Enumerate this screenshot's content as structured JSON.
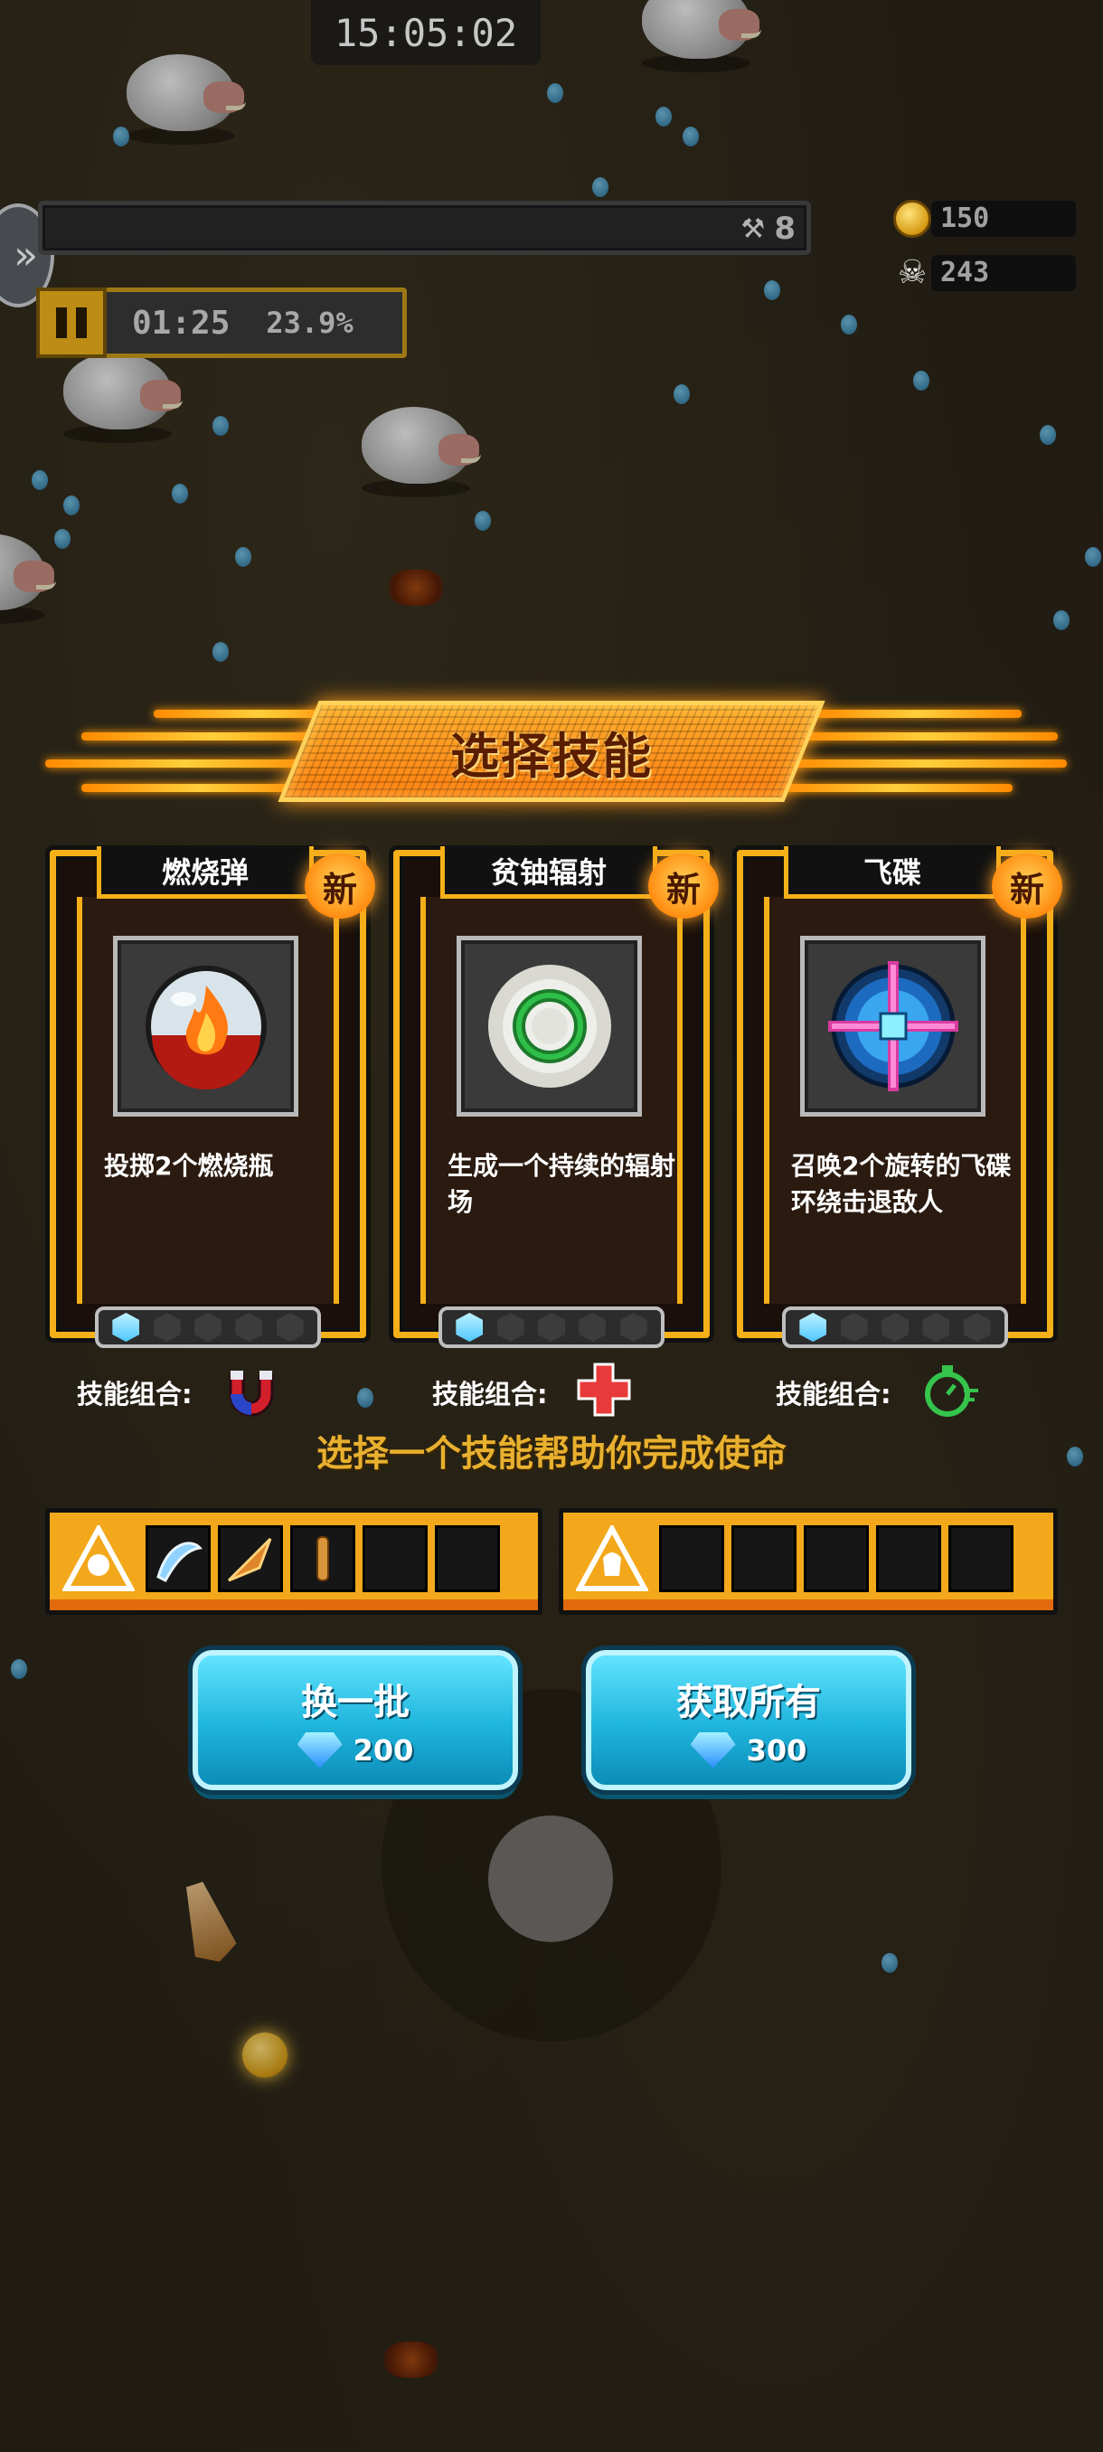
{
  "status_bar": {
    "time": "15:05:02"
  },
  "hud": {
    "level": "8",
    "timer": "01:25",
    "progress_percent": "23.9%",
    "coins": "150",
    "kills": "243"
  },
  "dialog": {
    "title": "选择技能",
    "new_badge": "新",
    "combo_label": "技能组合:",
    "hint": "选择一个技能帮助你完成使命",
    "cards": [
      {
        "name": "燃烧弹",
        "description": "投掷2个燃烧瓶",
        "combo_icon": "magnet-icon"
      },
      {
        "name": "贫铀辐射",
        "description": "生成一个持续的辐射场",
        "combo_icon": "medkit-cross-icon"
      },
      {
        "name": "飞碟",
        "description": "召唤2个旋转的飞碟环绕击退敌人",
        "combo_icon": "stopwatch-icon"
      }
    ],
    "reroll_button": {
      "label": "换一批",
      "cost": "200"
    },
    "take_all_button": {
      "label": "获取所有",
      "cost": "300"
    }
  },
  "colors": {
    "frame_gold": "#f4b019",
    "button_cyan": "#1eb4dc",
    "hint_gold": "#e8b02f"
  }
}
